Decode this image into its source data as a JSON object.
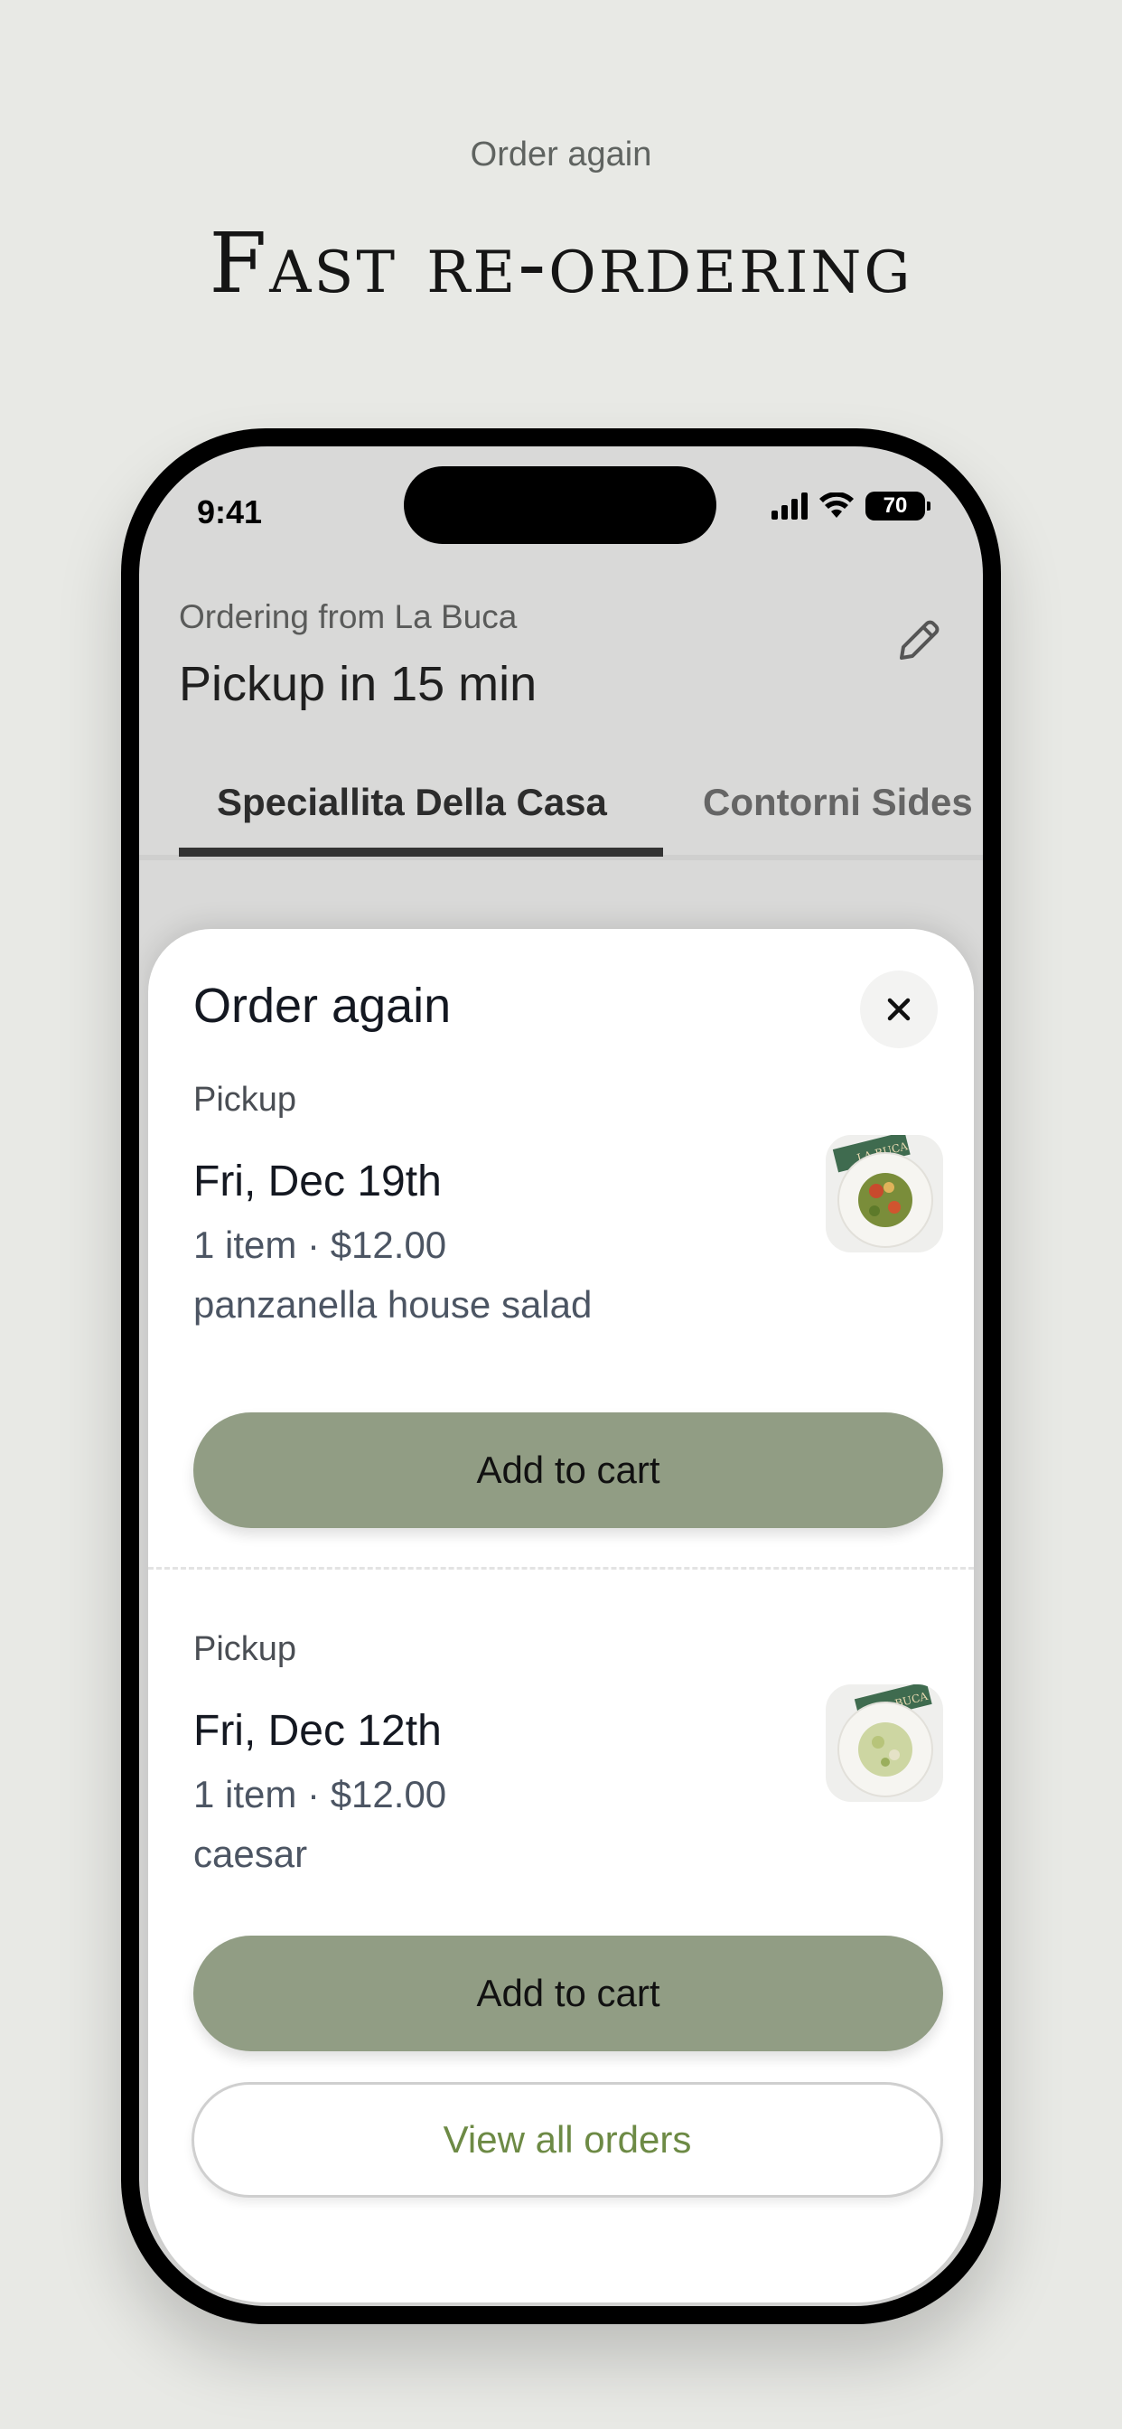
{
  "hero": {
    "eyebrow": "Order again",
    "headline": "Fast re-ordering"
  },
  "status_bar": {
    "time": "9:41",
    "battery": "70"
  },
  "header": {
    "ordering_from": "Ordering from La Buca",
    "pickup_time": "Pickup in 15 min",
    "edit_icon": "pencil-icon"
  },
  "tabs": [
    {
      "label": "Speciallita Della Casa",
      "active": true
    },
    {
      "label": "Contorni Sides",
      "active": false
    }
  ],
  "sheet": {
    "title": "Order again",
    "close_icon": "close-icon",
    "orders": [
      {
        "type": "Pickup",
        "date": "Fri, Dec 19th",
        "summary": "1 item · $12.00",
        "items": "panzanella house salad",
        "thumb_label": "LA BUCA",
        "button": "Add to cart"
      },
      {
        "type": "Pickup",
        "date": "Fri, Dec 12th",
        "summary": "1 item · $12.00",
        "items": "caesar",
        "thumb_label": "LA BUCA",
        "button": "Add to cart"
      }
    ],
    "view_all": "View all orders"
  },
  "colors": {
    "accent_green": "#919d84",
    "link_green": "#6d8a45",
    "background": "#e8e9e5"
  }
}
